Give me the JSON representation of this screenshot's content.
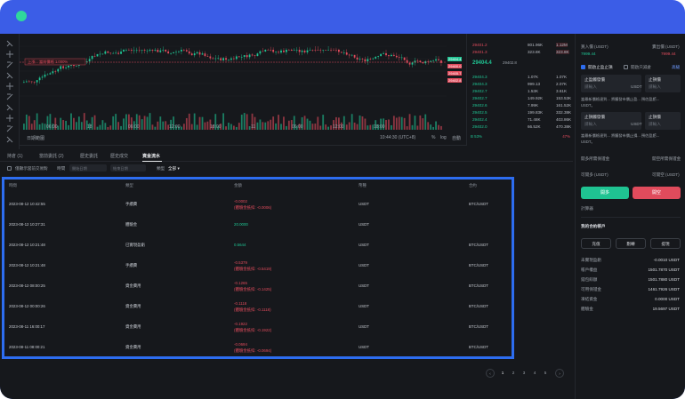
{
  "colors": {
    "frame": "#3b5de7",
    "bg": "#16181c",
    "up": "#1fc392",
    "down": "#e04b5c",
    "highlight": "#2d6df0",
    "window_dot": "#2fd89c"
  },
  "toolbar": {
    "icons": [
      "cursor-icon",
      "crosshair-icon",
      "trendline-icon",
      "brush-icon",
      "text-icon",
      "ruler-icon",
      "zoom-icon",
      "magnet-icon",
      "lock-icon",
      "trash-icon"
    ]
  },
  "chart": {
    "range_label": "日期範圍",
    "time_display": "10:44:30 (UTC+8)",
    "scale_percent": "%",
    "scale_log": "log",
    "scale_auto": "自動",
    "time_ticks": [
      "06:00",
      "18",
      "06:00",
      "12:00",
      "18:00",
      "11",
      "06:00",
      "12:00",
      "18:00"
    ],
    "price_tags": [
      "29404.4",
      "29400.0",
      "29405.7",
      "29402.8"
    ],
    "order_tag": "上漲... 當前價格 1.000%"
  },
  "order_book": {
    "asks": [
      {
        "price": "29401.2",
        "qty": "801.96K",
        "sum": "1.12M"
      },
      {
        "price": "29401.3",
        "qty": "323.8K",
        "sum": "323.8K"
      }
    ],
    "mid_price": "29404.4",
    "mid_sub": "29402.8",
    "bids": [
      {
        "price": "29404.3",
        "qty": "1.07K",
        "sum": "1.07K"
      },
      {
        "price": "29404.3",
        "qty": "999.13",
        "sum": "2.07K"
      },
      {
        "price": "29402.7",
        "qty": "1.53K",
        "sum": "3.61K"
      },
      {
        "price": "29402.7",
        "qty": "149.92K",
        "sum": "153.53K"
      },
      {
        "price": "29402.6",
        "qty": "7.99K",
        "sum": "161.52K"
      },
      {
        "price": "29402.5",
        "qty": "199.83K",
        "sum": "332.38K"
      },
      {
        "price": "29402.4",
        "qty": "71.48K",
        "sum": "403.86K"
      },
      {
        "price": "29402.0",
        "qty": "66.52K",
        "sum": "470.38K"
      }
    ],
    "ratio_buy": "B 53%",
    "ratio_sell": "47%"
  },
  "tabs": [
    "持倉 (1)",
    "當前委託 (2)",
    "歷史委託",
    "歷史成交",
    "資金流水"
  ],
  "tab_active_index": 4,
  "filters": {
    "checkbox_label": "僅顯示當前交易對",
    "time_label": "時間",
    "time_placeholder": "開始日期",
    "time_end_placeholder": "結束日期",
    "type_label": "類型",
    "type_value": "全部"
  },
  "table": {
    "headers": [
      "時間",
      "類型",
      "金額",
      "幣種",
      "合約"
    ],
    "rows": [
      {
        "time": "2023-08-12 10:42:55",
        "type": "手續費",
        "amount": "-0.0002",
        "amount_sub": "(體驗金抵扣: -0.0006)",
        "coin": "USDT",
        "contract": "BTC/USDT",
        "sign": "neg"
      },
      {
        "time": "2023-08-12 10:27:31",
        "type": "體驗金",
        "amount": "20.0000",
        "amount_sub": "",
        "coin": "USDT",
        "contract": "",
        "sign": "pos"
      },
      {
        "time": "2023-08-12 10:21:48",
        "type": "已實現盈虧",
        "amount": "0.5644",
        "amount_sub": "",
        "coin": "USDT",
        "contract": "BTC/USDT",
        "sign": "pos"
      },
      {
        "time": "2023-08-12 10:21:48",
        "type": "手續費",
        "amount": "-0.5379",
        "amount_sub": "(體驗金抵扣: -0.5419)",
        "coin": "USDT",
        "contract": "BTC/USDT",
        "sign": "neg"
      },
      {
        "time": "2023-08-12 08:00:25",
        "type": "資金費用",
        "amount": "-0.1265",
        "amount_sub": "(體驗金抵扣: -0.1425)",
        "coin": "USDT",
        "contract": "BTC/USDT",
        "sign": "neg"
      },
      {
        "time": "2023-08-12 00:00:26",
        "type": "資金費用",
        "amount": "-0.1118",
        "amount_sub": "(體驗金抵扣: -0.1118)",
        "coin": "USDT",
        "contract": "BTC/USDT",
        "sign": "neg"
      },
      {
        "time": "2023-08-11 16:00:17",
        "type": "資金費用",
        "amount": "-0.1922",
        "amount_sub": "(體驗金抵扣: -0.1922)",
        "coin": "USDT",
        "contract": "BTC/USDT",
        "sign": "neg"
      },
      {
        "time": "2023-08-11 08:00:21",
        "type": "資金費用",
        "amount": "-0.0694",
        "amount_sub": "(體驗金抵扣: -0.0694)",
        "coin": "USDT",
        "contract": "BTC/USDT",
        "sign": "neg"
      }
    ]
  },
  "pager": {
    "prev": "‹",
    "pages": [
      "1",
      "2",
      "3",
      "4",
      "5"
    ],
    "next": "›"
  },
  "panel": {
    "top_left_label": "買入價 (USDT)",
    "top_left_value": "7999.44",
    "top_right_label": "賣出價 (USDT)",
    "top_right_value": "7999.44",
    "check_tp": "開啟止盈止損",
    "check_reduce": "開啟只減倉",
    "advanced": "高級",
    "tp_label": "止盈觸發價",
    "tp_input": "請輸入",
    "tp_unit": "USDT",
    "sl_label": "止損價",
    "sl_input": "請輸入",
    "desc_1": "當最新價格達到... 將觸發市價止盈... 預估盈虧...",
    "desc_1_unit": "USDT。",
    "tp2_label": "止損觸發價",
    "tp2_input": "請輸入",
    "tp2_unit": "USDT",
    "sl2_label": "止損價",
    "sl2_input": "請輸入",
    "desc_2": "當最新價格達到... 將觸發市價止損... 預估盈虧...",
    "desc_2_unit": "USDT。",
    "avail_buy_label": "開多所需保證金",
    "avail_sell_label": "開空所需保證金",
    "max_buy_label": "可開多 (USDT)",
    "max_sell_label": "可開空 (USDT)",
    "buy_button": "開多",
    "sell_button": "開空",
    "calc_link": "計算器",
    "account_title": "我的合約帳戶",
    "deposit": "充值",
    "transfer": "劃轉",
    "withdraw": "提現",
    "rows": [
      {
        "label": "未實現盈虧",
        "value": "-0.0010 USDT"
      },
      {
        "label": "帳戶權益",
        "value": "1501.7870 USDT"
      },
      {
        "label": "錢包餘額",
        "value": "1501.7880 USDT"
      },
      {
        "label": "可用保證金",
        "value": "1461.7926 USDT"
      },
      {
        "label": "凍結資金",
        "value": "0.0000 USDT"
      },
      {
        "label": "體驗金",
        "value": "19.5697 USDT"
      }
    ]
  }
}
